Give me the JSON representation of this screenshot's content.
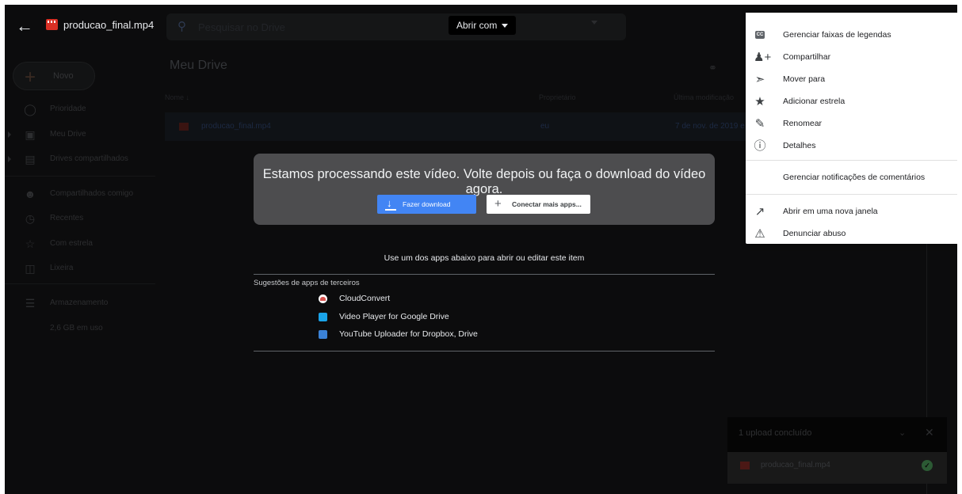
{
  "header": {
    "file_title": "producao_final.mp4",
    "search_placeholder": "Pesquisar no Drive",
    "open_with_label": "Abrir com"
  },
  "sidebar": {
    "new_label": "Novo",
    "items": [
      {
        "label": "Prioridade",
        "icon": "check-circle-icon"
      },
      {
        "label": "Meu Drive",
        "icon": "drive-icon"
      },
      {
        "label": "Drives compartilhados",
        "icon": "shared-drives-icon"
      },
      {
        "label": "Compartilhados comigo",
        "icon": "people-icon"
      },
      {
        "label": "Recentes",
        "icon": "clock-icon"
      },
      {
        "label": "Com estrela",
        "icon": "star-outline-icon"
      },
      {
        "label": "Lixeira",
        "icon": "trash-icon"
      },
      {
        "label": "Armazenamento",
        "icon": "storage-icon"
      }
    ],
    "storage_used": "2,6 GB em uso"
  },
  "main": {
    "title": "Meu Drive",
    "columns": {
      "name": "Nome",
      "owner": "Proprietário",
      "modified": "Última modificação"
    },
    "row": {
      "name": "producao_final.mp4",
      "owner": "eu",
      "modified": "7 de nov. de 2019 e"
    }
  },
  "preview": {
    "message": "Estamos processando este vídeo. Volte depois ou faça o download do vídeo agora.",
    "download_label": "Fazer download",
    "connect_label": "Conectar mais apps...",
    "apps_hint": "Use um dos apps abaixo para abrir ou editar este item",
    "suggestions_title": "Sugestões de apps de terceiros",
    "apps": [
      {
        "label": "CloudConvert",
        "color": "#d9534f"
      },
      {
        "label": "Video Player for Google Drive",
        "color": "#1aa3e8"
      },
      {
        "label": "YouTube Uploader for Dropbox, Drive",
        "color": "#3b82d6"
      }
    ]
  },
  "context_menu": {
    "items": [
      {
        "label": "Gerenciar faixas de legendas",
        "icon": "closed-captions-icon"
      },
      {
        "label": "Compartilhar",
        "icon": "add-person-icon"
      },
      {
        "label": "Mover para",
        "icon": "move-folder-icon"
      },
      {
        "label": "Adicionar estrela",
        "icon": "star-icon"
      },
      {
        "label": "Renomear",
        "icon": "pencil-icon"
      },
      {
        "label": "Detalhes",
        "icon": "info-icon"
      },
      {
        "label": "Gerenciar notificações de comentários",
        "icon": ""
      },
      {
        "label": "Abrir em uma nova janela",
        "icon": "open-new-window-icon"
      },
      {
        "label": "Denunciar abuso",
        "icon": "report-icon"
      }
    ]
  },
  "upload": {
    "status": "1 upload concluído",
    "file_name": "producao_final.mp4"
  },
  "colors": {
    "download_button": "#4285f4",
    "processing_card": "#4d4d4f",
    "backdrop": "#0c0c0d"
  }
}
